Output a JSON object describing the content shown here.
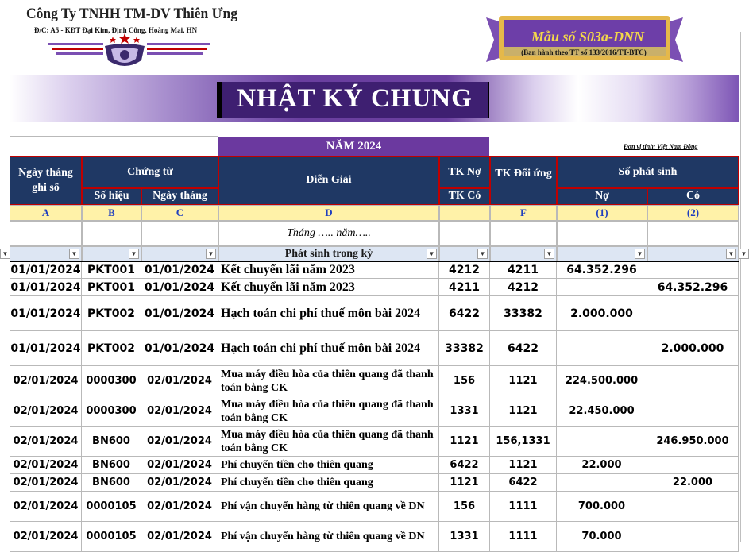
{
  "company": {
    "name": "Công Ty TNHH TM-DV Thiên Ưng",
    "address": "Đ/C: A5 - KĐT Đại Kim, Định Công, Hoàng Mai, HN"
  },
  "badge": {
    "title": "Mẫu số S03a-DNN",
    "subtitle": "(Ban hành theo TT số 133/2016/TT-BTC)"
  },
  "title": "NHẬT KÝ CHUNG",
  "year_label": "NĂM 2024",
  "unit_label": "Đơn vị tính: Việt Nam Đồng",
  "header": {
    "date_recorded": "Ngày tháng ghi sổ",
    "voucher": "Chứng từ",
    "voucher_no": "Số hiệu",
    "voucher_date": "Ngày tháng",
    "description": "Diễn Giải",
    "debit_account": "TK Nợ",
    "credit_account": "TK Có",
    "contra_account": "TK Đối ứng",
    "amount": "Số phát sinh",
    "debit": "Nợ",
    "credit": "Có"
  },
  "letters": [
    "A",
    "B",
    "C",
    "D",
    "",
    "F",
    "(1)",
    "(2)"
  ],
  "month_label": "Tháng ….. năm…..",
  "filter_label": "Phát sinh trong kỳ",
  "rows": [
    {
      "date": "01/01/2024",
      "no": "PKT001",
      "vdate": "01/01/2024",
      "desc": "Kết chuyển lãi năm 2023",
      "acc": "4212",
      "contra": "4211",
      "debit": "64.352.296",
      "credit": ""
    },
    {
      "date": "01/01/2024",
      "no": "PKT001",
      "vdate": "01/01/2024",
      "desc": "Kết chuyển lãi năm 2023",
      "acc": "4211",
      "contra": "4212",
      "debit": "",
      "credit": "64.352.296"
    },
    {
      "date": "01/01/2024",
      "no": "PKT002",
      "vdate": "01/01/2024",
      "desc": "Hạch toán chi phí thuế môn bài 2024",
      "acc": "6422",
      "contra": "33382",
      "debit": "2.000.000",
      "credit": ""
    },
    {
      "date": "01/01/2024",
      "no": "PKT002",
      "vdate": "01/01/2024",
      "desc": "Hạch toán chi phí thuế môn bài 2024",
      "acc": "33382",
      "contra": "6422",
      "debit": "",
      "credit": "2.000.000"
    },
    {
      "date": "02/01/2024",
      "no": "0000300",
      "vdate": "02/01/2024",
      "desc": "Mua máy điều hòa của thiên quang đã thanh toán bằng CK",
      "acc": "156",
      "contra": "1121",
      "debit": "224.500.000",
      "credit": ""
    },
    {
      "date": "02/01/2024",
      "no": "0000300",
      "vdate": "02/01/2024",
      "desc": "Mua máy điều hòa của thiên quang đã thanh toán bằng CK",
      "acc": "1331",
      "contra": "1121",
      "debit": "22.450.000",
      "credit": ""
    },
    {
      "date": "02/01/2024",
      "no": "BN600",
      "vdate": "02/01/2024",
      "desc": "Mua máy điều hòa của thiên quang đã thanh toán bằng CK",
      "acc": "1121",
      "contra": "156,1331",
      "debit": "",
      "credit": "246.950.000"
    },
    {
      "date": "02/01/2024",
      "no": "BN600",
      "vdate": "02/01/2024",
      "desc": "Phí chuyển tiền cho thiên quang",
      "acc": "6422",
      "contra": "1121",
      "debit": "22.000",
      "credit": ""
    },
    {
      "date": "02/01/2024",
      "no": "BN600",
      "vdate": "02/01/2024",
      "desc": "Phí chuyển tiền cho thiên quang",
      "acc": "1121",
      "contra": "6422",
      "debit": "",
      "credit": "22.000"
    },
    {
      "date": "02/01/2024",
      "no": "0000105",
      "vdate": "02/01/2024",
      "desc": "Phí vận chuyển hàng từ thiên quang về DN",
      "acc": "156",
      "contra": "1111",
      "debit": "700.000",
      "credit": ""
    },
    {
      "date": "02/01/2024",
      "no": "0000105",
      "vdate": "02/01/2024",
      "desc": "Phí vận chuyển hàng từ thiên quang về DN",
      "acc": "1331",
      "contra": "1111",
      "debit": "70.000",
      "credit": ""
    }
  ],
  "colors": {
    "header_bg": "#1f3864",
    "accent_purple": "#6b399f",
    "letter_row": "#fff2a8",
    "filter_row": "#dde6f3"
  }
}
